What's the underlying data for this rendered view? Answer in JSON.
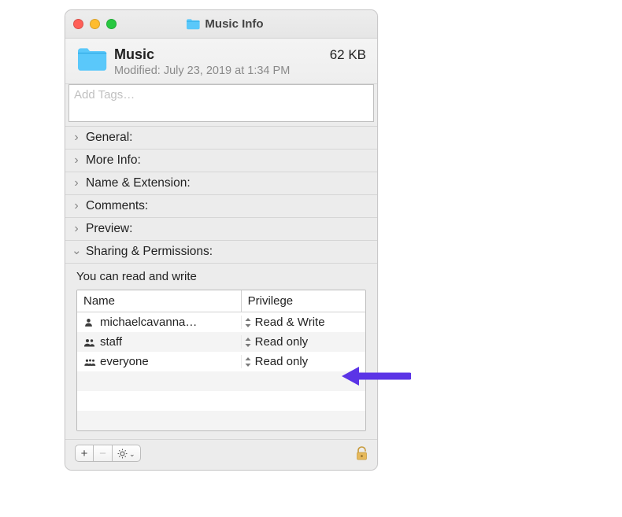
{
  "window": {
    "title": "Music Info"
  },
  "header": {
    "name": "Music",
    "size": "62 KB",
    "modified": "Modified:  July 23, 2019 at 1:34 PM"
  },
  "tags": {
    "placeholder": "Add Tags…"
  },
  "sections": {
    "general": "General:",
    "more_info": "More Info:",
    "name_ext": "Name & Extension:",
    "comments": "Comments:",
    "preview": "Preview:",
    "sharing": "Sharing & Permissions:"
  },
  "sharing": {
    "note": "You can read and write",
    "columns": {
      "name": "Name",
      "privilege": "Privilege"
    },
    "rows": [
      {
        "icon": "single",
        "name": "michaelcavanna…",
        "priv": "Read & Write"
      },
      {
        "icon": "double",
        "name": "staff",
        "priv": "Read only"
      },
      {
        "icon": "triple",
        "name": "everyone",
        "priv": "Read only"
      }
    ]
  },
  "footer": {
    "add": "+",
    "remove": "−",
    "gear": "⊙"
  }
}
